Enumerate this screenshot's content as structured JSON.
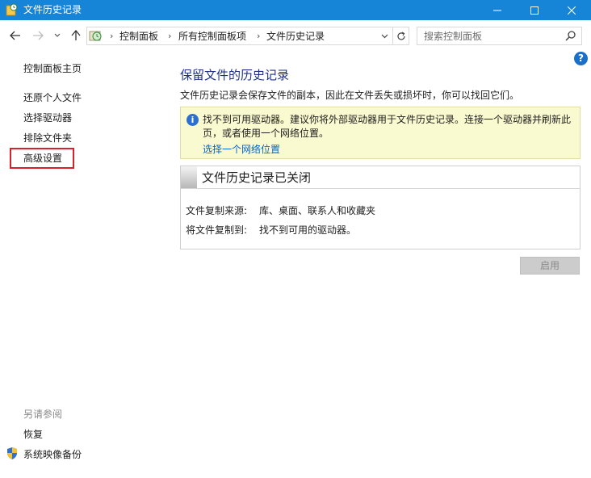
{
  "window": {
    "title": "文件历史记录"
  },
  "address": {
    "crumbs": [
      "控制面板",
      "所有控制面板项",
      "文件历史记录"
    ]
  },
  "search": {
    "placeholder": "搜索控制面板"
  },
  "help": {
    "label": "?"
  },
  "sidebar": {
    "items": [
      {
        "label": "控制面板主页"
      },
      {
        "label": "还原个人文件"
      },
      {
        "label": "选择驱动器"
      },
      {
        "label": "排除文件夹"
      },
      {
        "label": "高级设置"
      }
    ],
    "see_also_heading": "另请参阅",
    "see_also": [
      {
        "label": "恢复"
      },
      {
        "label": "系统映像备份"
      }
    ]
  },
  "main": {
    "title": "保留文件的历史记录",
    "description": "文件历史记录会保存文件的副本，因此在文件丢失或损坏时，你可以找回它们。",
    "info": {
      "icon_text": "i",
      "message": "找不到可用驱动器。建议你将外部驱动器用于文件历史记录。连接一个驱动器并刷新此页，或者使用一个网络位置。",
      "link": "选择一个网络位置"
    },
    "status": {
      "heading": "文件历史记录已关闭",
      "rows": [
        {
          "label": "文件复制来源:",
          "value": "库、桌面、联系人和收藏夹"
        },
        {
          "label": "将文件复制到:",
          "value": "找不到可用的驱动器。"
        }
      ]
    },
    "enable_button": "启用"
  },
  "colors": {
    "titlebar": "#1685d8",
    "heading_blue": "#1e3287",
    "link_blue": "#0066cc",
    "info_bg": "#fafad0",
    "highlight_red": "#d9202b"
  }
}
